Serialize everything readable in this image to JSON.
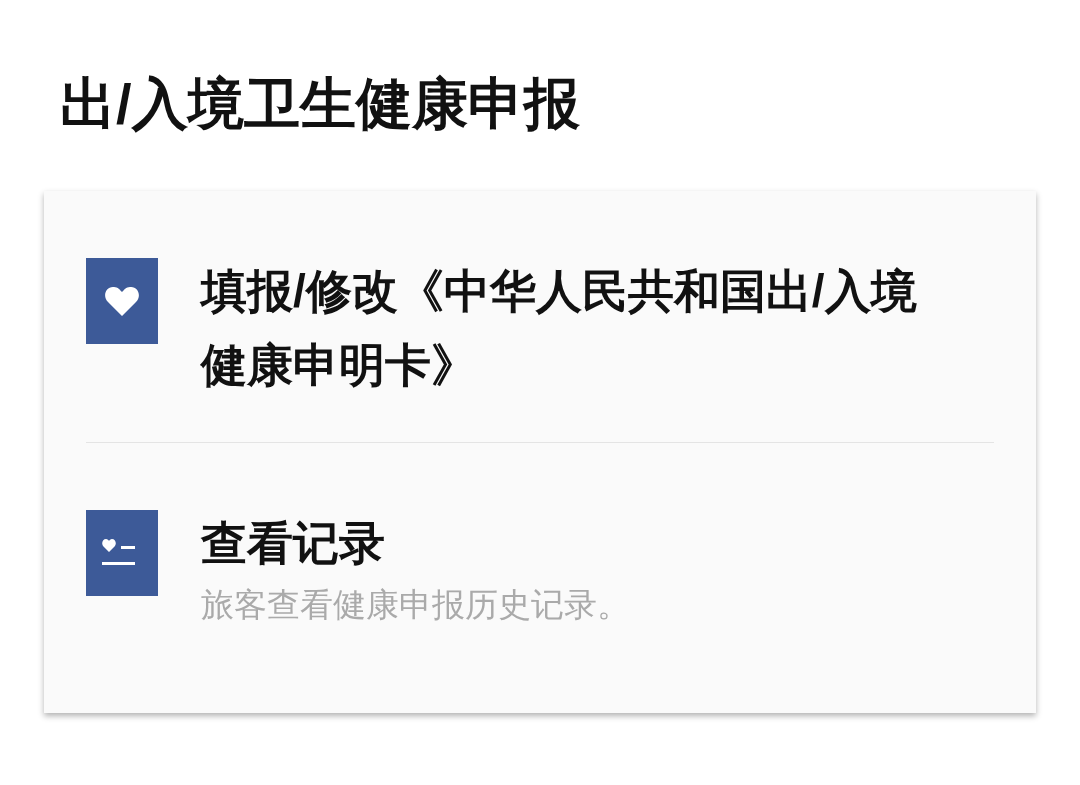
{
  "title": "出/入境卫生健康申报",
  "items": [
    {
      "title": "填报/修改《中华人民共和国出/入境健康申明卡》"
    },
    {
      "title": "查看记录",
      "subtitle": "旅客查看健康申报历史记录。"
    }
  ]
}
